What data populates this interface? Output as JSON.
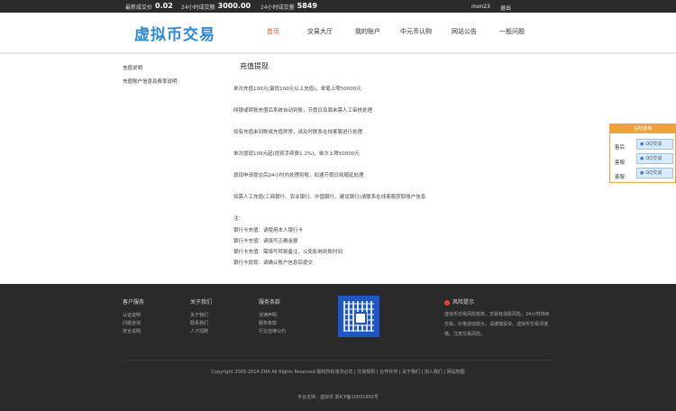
{
  "topbar": {
    "stats": [
      {
        "label": "最新成交价",
        "value": "0.02"
      },
      {
        "label": "24小时成交额",
        "value": "3000.00"
      },
      {
        "label": "24小时成交量",
        "value": "5849"
      }
    ],
    "username": "mxn23",
    "logout": "退出"
  },
  "header": {
    "logo": "虚拟币交易",
    "nav": [
      "首页",
      "交易大厅",
      "我的账户",
      "中元币认购",
      "网站公告",
      "一般问题"
    ]
  },
  "sidebar": {
    "links": [
      "充值说明",
      "充值账户信息及费率说明"
    ]
  },
  "content": {
    "title": "充值提现",
    "paragraphs": [
      "单次充值100元(最低100元以上充值)，单笔上限50000元",
      "网银或转账充值后系统自动到账，节假日及周末需人工审核处理",
      "如有充值未到账或充值异常，请及时联系在线客服进行处理",
      "单次提现100元起(提现手续费1.2%)，单次上限50000元",
      "提现申请提交后24小时内处理到账，如遇节假日则顺延处理",
      "如需人工充值(工商银行、农业银行、中国银行、建设银行)请联系在线客服获取账户信息"
    ],
    "notes_label": "注：",
    "notes": [
      "银行卡充值：请使用本人银行卡",
      "银行卡充值：请填写正确金额",
      "银行卡充值：需填写转账备注，以免影响到账时间",
      "银行卡提现：请确认账户信息后提交"
    ]
  },
  "service": {
    "header": "在线咨询",
    "rows": [
      {
        "label": "售后",
        "qq": "QQ交谈"
      },
      {
        "label": "客服",
        "qq": "QQ交谈"
      },
      {
        "label": "客服",
        "qq": "QQ交谈"
      }
    ]
  },
  "footer": {
    "columns": [
      {
        "title": "客户服务",
        "items": [
          "认证说明",
          "问题咨询",
          "安全说明"
        ]
      },
      {
        "title": "关于我们",
        "items": [
          "关于我们",
          "联系我们",
          "人才招聘"
        ]
      },
      {
        "title": "服务条款",
        "items": [
          "法律声明",
          "服务条款",
          "行业自律公约"
        ]
      }
    ],
    "risk_title": "风险提示",
    "risk_text": "虚拟币交易风险较高，交易有涨跌风险，24小时持续交易，价格波动较大，请谨慎投资。虚拟币交易须谨慎，注意交易风险。",
    "copyright": "Copyright 2005-2014 ZHA All Rights Reserved 版权所有违法必究 | 交易规则 | 合作伙伴 | 关于我们 | 加入我们 | 网站地图",
    "support": "平台支持：虚拟币 浙ICP备10001891号"
  }
}
